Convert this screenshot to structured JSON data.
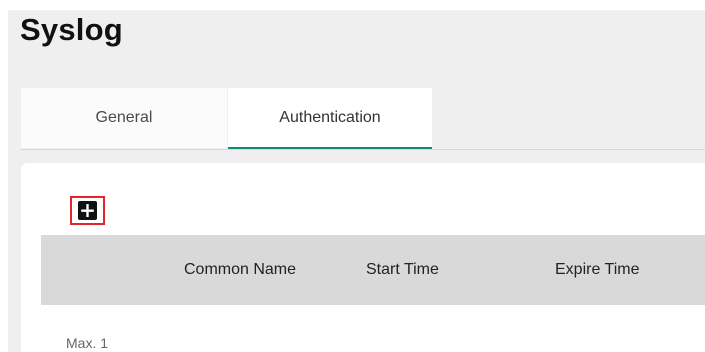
{
  "page": {
    "title": "Syslog"
  },
  "tabs": [
    {
      "label": "General",
      "active": false
    },
    {
      "label": "Authentication",
      "active": true
    }
  ],
  "toolbar": {
    "add_icon": "plus-icon"
  },
  "table": {
    "columns": [
      "",
      "Common Name",
      "Start Time",
      "Expire Time"
    ]
  },
  "footer": {
    "max_text": "Max. 1"
  },
  "colors": {
    "active_tab_underline": "#138a74",
    "highlight_border": "#e0262e",
    "table_header_bg": "#d9d9d9"
  }
}
